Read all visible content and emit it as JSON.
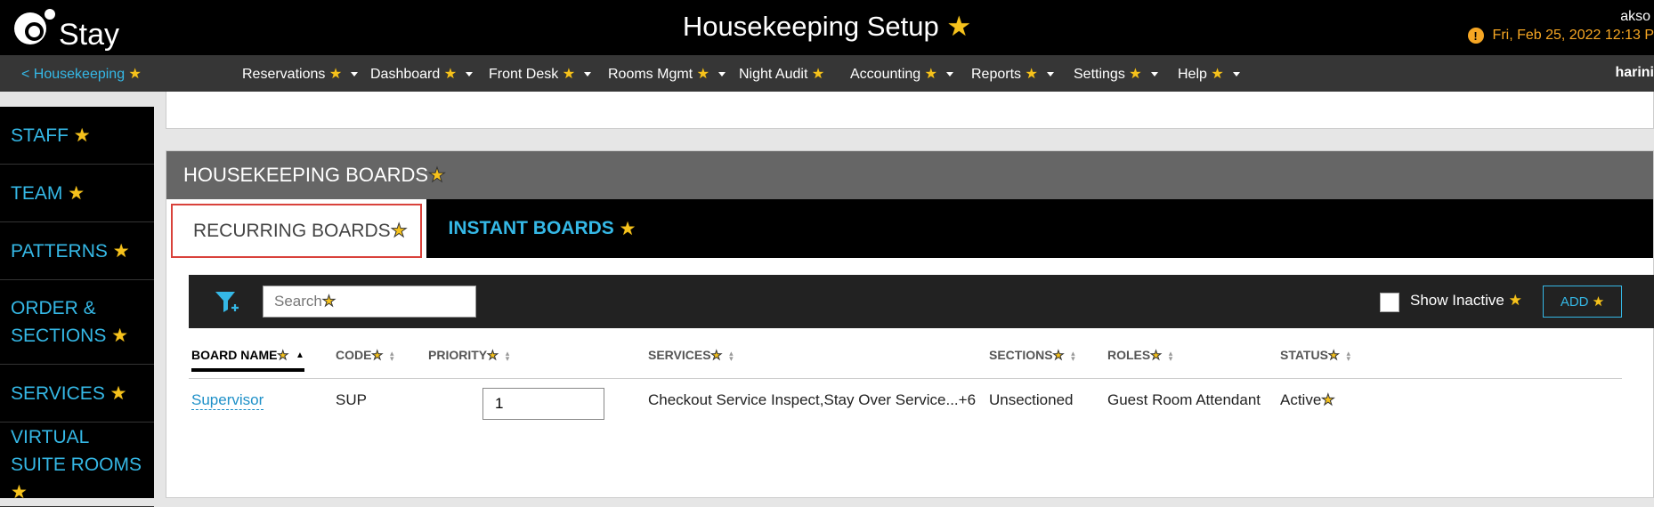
{
  "header": {
    "logo_text": "Stay",
    "title": "Housekeeping Setup",
    "user": "akso",
    "datetime": "Fri, Feb 25, 2022 12:13 P",
    "warning_icon": "exclamation-circle-icon"
  },
  "nav": {
    "breadcrumb": "< Housekeeping",
    "items": [
      {
        "label": "Reservations",
        "dropdown": true
      },
      {
        "label": "Dashboard",
        "dropdown": true
      },
      {
        "label": "Front Desk",
        "dropdown": true
      },
      {
        "label": "Rooms Mgmt",
        "dropdown": true
      },
      {
        "label": "Night Audit",
        "dropdown": false
      },
      {
        "label": "Accounting",
        "dropdown": true
      },
      {
        "label": "Reports",
        "dropdown": true
      },
      {
        "label": "Settings",
        "dropdown": true
      },
      {
        "label": "Help",
        "dropdown": true
      }
    ],
    "user": "harini"
  },
  "sidebar": {
    "items": [
      {
        "label": "STAFF"
      },
      {
        "label": "TEAM"
      },
      {
        "label": "PATTERNS"
      },
      {
        "label": "ORDER & SECTIONS"
      },
      {
        "label": "SERVICES"
      },
      {
        "label": "VIRTUAL SUITE ROOMS"
      }
    ]
  },
  "panel": {
    "title": "HOUSEKEEPING BOARDS",
    "tabs": [
      {
        "label": "RECURRING BOARDS",
        "selected": true
      },
      {
        "label": "INSTANT BOARDS",
        "selected": false
      }
    ],
    "toolbar": {
      "search_placeholder": "Search",
      "show_inactive_label": "Show Inactive",
      "show_inactive_checked": false,
      "add_label": "ADD"
    },
    "table": {
      "columns": [
        "BOARD NAME",
        "CODE",
        "PRIORITY",
        "SERVICES",
        "SECTIONS",
        "ROLES",
        "STATUS"
      ],
      "sorted_column": "BOARD NAME",
      "rows": [
        {
          "board_name": "Supervisor",
          "code": "SUP",
          "priority": "1",
          "services": "Checkout Service Inspect,Stay Over Service...+6",
          "sections": "Unsectioned",
          "roles": "Guest Room Attendant",
          "status": "Active"
        }
      ]
    }
  },
  "colors": {
    "accent": "#35b8e6",
    "star": "#f6c21c",
    "warning": "#f6a623",
    "selected_tab_border": "#d9423b"
  }
}
